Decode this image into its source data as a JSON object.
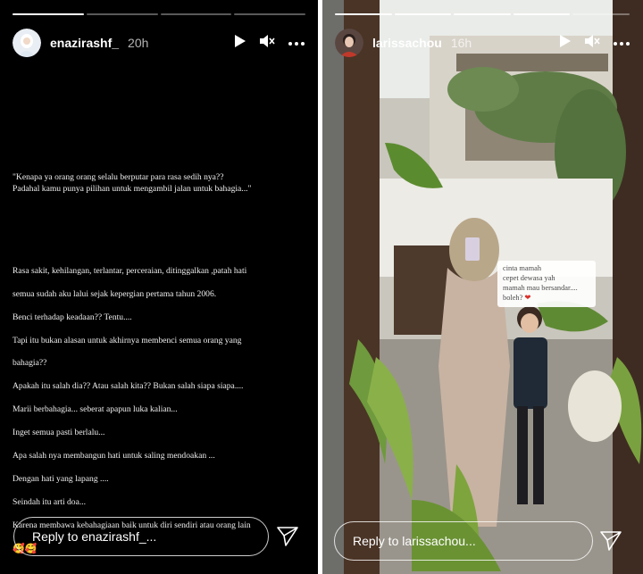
{
  "left_story": {
    "username": "enazirashf_",
    "time": "20h",
    "progress": {
      "segments": 4,
      "active_index": 0
    },
    "quote": "\"Kenapa ya orang orang selalu berputar para rasa sedih nya??\nPadahal kamu punya pilihan untuk mengambil jalan untuk bahagia...\"",
    "body_lines": [
      "Rasa sakit, kehilangan, terlantar, perceraian, ditinggalkan ,patah hati",
      "semua sudah aku lalui sejak kepergian pertama tahun 2006.",
      "Benci terhadap keadaan?? Tentu....",
      "Tapi itu bukan alasan untuk akhirnya membenci semua orang yang",
      "bahagia??",
      "Apakah itu salah dia?? Atau salah kita?? Bukan salah siapa siapa....",
      "Marii berbahagia... seberat apapun luka kalian...",
      "Inget semua pasti berlalu...",
      "Apa salah nya membangun hati untuk saling mendoakan ...",
      "Dengan hati yang lapang ....",
      "Seindah itu arti doa...",
      "Karena membawa kebahagiaan baik untuk diri sendiri atau orang lain"
    ],
    "emoji_line": "🥰🥰",
    "reply_placeholder": "Reply to enazirashf_..."
  },
  "right_story": {
    "username": "larissachou",
    "time": "16h",
    "progress": {
      "segments": 5,
      "active_index": 4
    },
    "sticker_lines": [
      "cinta mamah",
      "cepet dewasa yah",
      "mamah mau bersandar....",
      "boleh? "
    ],
    "sticker_heart": "❤",
    "reply_placeholder": "Reply to larissachou..."
  },
  "colors": {
    "story_bg_left": "#000000",
    "text": "#ffffff",
    "heart": "#d9312b"
  },
  "icons": [
    "play-icon",
    "mute-icon",
    "more-icon",
    "send-icon"
  ]
}
